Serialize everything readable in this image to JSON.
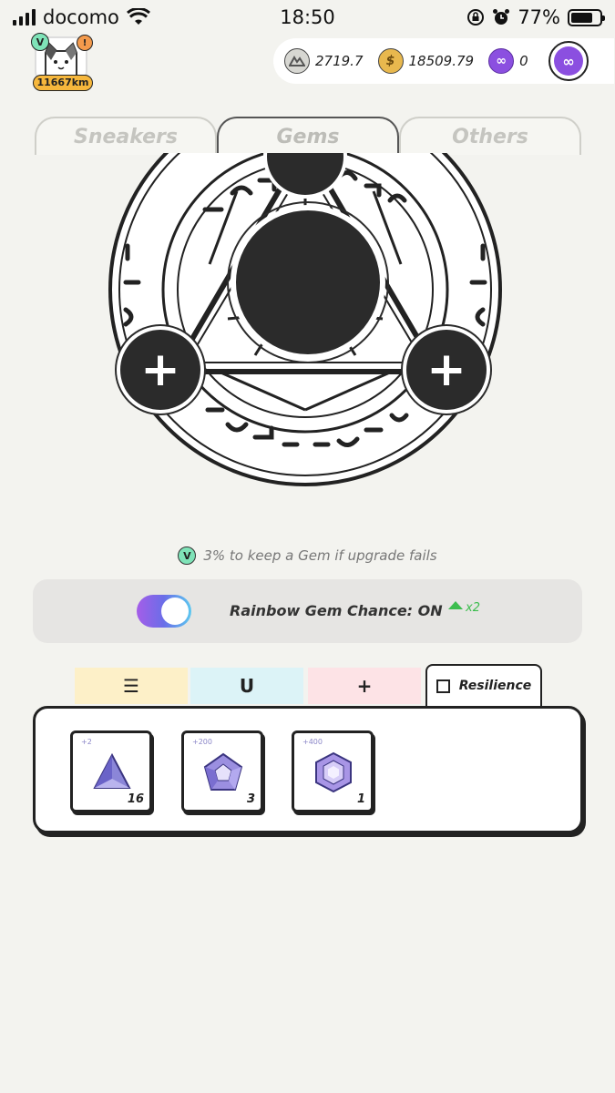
{
  "status_bar": {
    "carrier": "docomo",
    "time": "18:50",
    "battery": "77%",
    "battery_level": 0.77
  },
  "profile": {
    "level_badge": "V",
    "alert_badge": "!",
    "distance": "11667km"
  },
  "balances": {
    "gst": "2719.7",
    "gmt": "18509.79",
    "matic": "0"
  },
  "tabs": [
    {
      "label": "Sneakers",
      "active": false
    },
    {
      "label": "Gems",
      "active": true
    },
    {
      "label": "Others",
      "active": false
    }
  ],
  "upgrade": {
    "keep_badge": "V",
    "keep_note": "3% to keep a Gem if upgrade fails"
  },
  "rainbow": {
    "label": "Rainbow Gem Chance: ON",
    "toggle_on": true,
    "boost": "x2"
  },
  "filters": [
    {
      "icon": "efficiency-icon",
      "glyph": "☰"
    },
    {
      "icon": "luck-icon",
      "glyph": "U"
    },
    {
      "icon": "comfort-icon",
      "glyph": "+"
    },
    {
      "icon": "resilience-icon",
      "label": "Resilience",
      "active": true
    }
  ],
  "gems": [
    {
      "bonus": "+2",
      "count": "16",
      "shape": "triangle"
    },
    {
      "bonus": "+200",
      "count": "3",
      "shape": "pentagon"
    },
    {
      "bonus": "+400",
      "count": "1",
      "shape": "hexagon"
    }
  ],
  "colors": {
    "background": "#f3f3ef",
    "gem_purple": "#8b86d8",
    "toggle_gradient_start": "#a55de8",
    "toggle_gradient_end": "#5cc8f0",
    "boost_green": "#3cbd4e"
  }
}
